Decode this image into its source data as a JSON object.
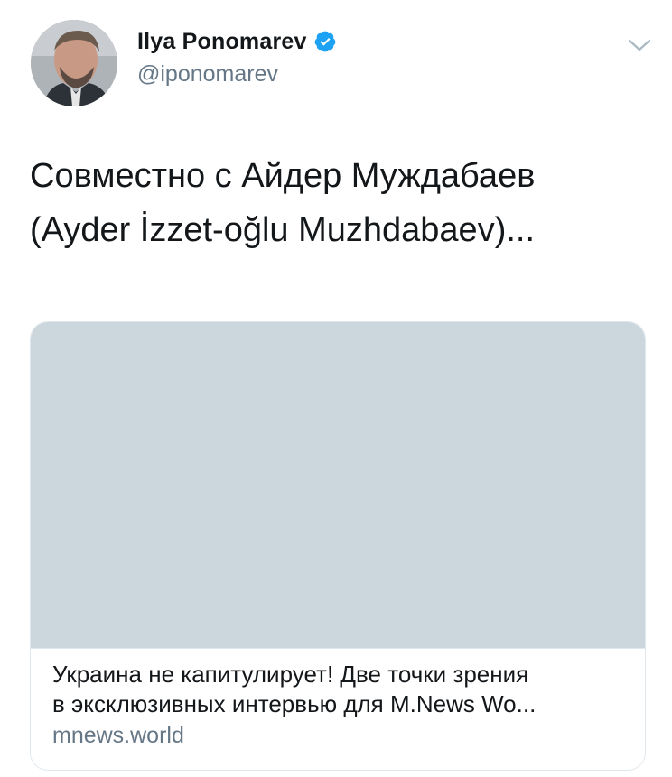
{
  "tweet": {
    "author": {
      "display_name": "Ilya Ponomarev",
      "handle": "@iponomarev",
      "verified": true,
      "avatar_icon": "user-avatar-photo"
    },
    "menu_icon": "chevron-down-icon",
    "text_lines": [
      "Совместно с Айдер Муждабаев",
      "(Ayder İzzet-oğlu Muzhdabaev)..."
    ],
    "card": {
      "title_lines": [
        "Украина не капитулирует! Две точки зрения",
        "в эксклюзивных интервью для M.News Wo..."
      ],
      "domain": "mnews.world",
      "image_placeholder_color": "#ccd6dd"
    }
  },
  "colors": {
    "verified_blue": "#1da1f2",
    "secondary_text": "#657786",
    "primary_text": "#14171a",
    "card_border": "#e1e8ed"
  }
}
